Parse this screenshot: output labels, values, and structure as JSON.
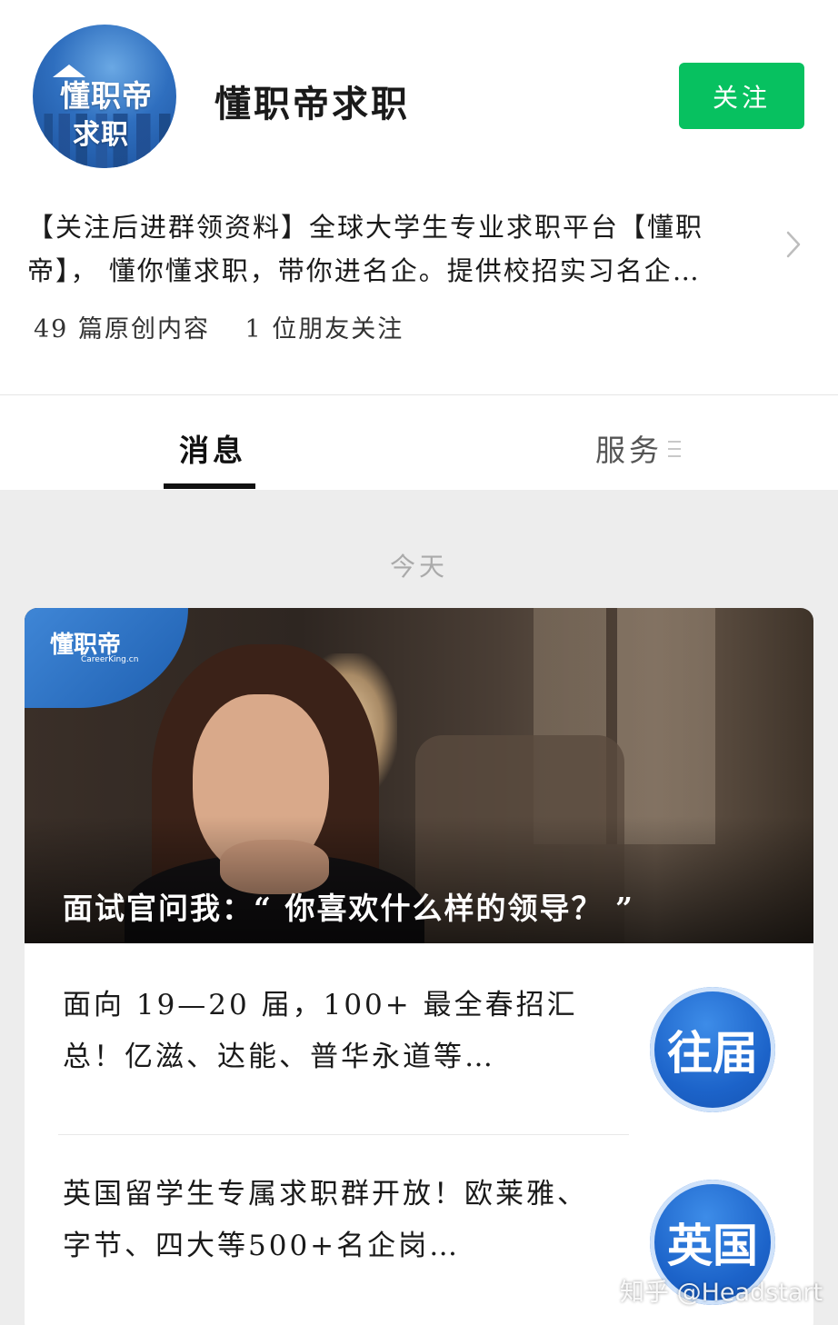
{
  "profile": {
    "avatar_line1": "懂职帝",
    "avatar_line2": "求职",
    "name": "懂职帝求职",
    "follow_label": "关注",
    "description": "【关注后进群领资料】全球大学生专业求职平台【懂职帝】， 懂你懂求职，带你进名企。提供校招实习名企…",
    "original_count": "49 篇原创内容",
    "friends_following": "1 位朋友关注"
  },
  "tabs": {
    "messages": "消息",
    "services": "服务"
  },
  "feed": {
    "date_label": "今天",
    "cover": {
      "brand": "懂职帝",
      "brand_sub": "CareerKing.cn",
      "title": "面试官问我：“ 你喜欢什么样的领导？ ”"
    },
    "articles": [
      {
        "title": "面向 19—20 届，100+ 最全春招汇总！亿滋、达能、普华永道等…",
        "thumb_text": "往届"
      },
      {
        "title": "英国留学生专属求职群开放！欧莱雅、字节、四大等500+名企岗…",
        "thumb_text": "英国"
      }
    ]
  },
  "watermark": "知乎 @Headstart",
  "colors": {
    "follow_button": "#07c160",
    "feed_background": "#ededed",
    "brand_blue": "#1c63c9"
  }
}
